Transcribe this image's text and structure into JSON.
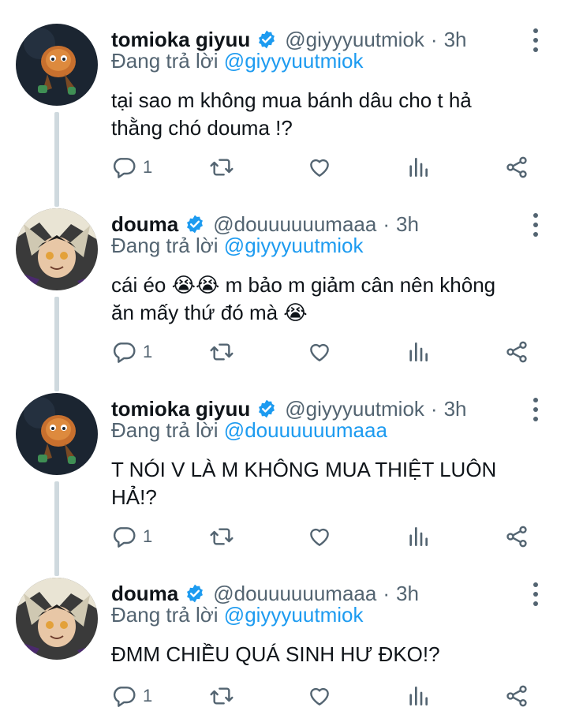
{
  "replying_prefix": "Đang trả lời",
  "tweets": [
    {
      "name": "tomioka giyuu",
      "handle": "@giyyyuutmiok",
      "dot": "·",
      "time": "3h",
      "reply_to": "@giyyyuutmiok",
      "text": "tại sao m không mua bánh dâu cho t hả\nthằng chó douma !?",
      "reply_count": "1",
      "avatar": "giyuu-avatar"
    },
    {
      "name": "douma",
      "handle": "@douuuuuumaaa",
      "dot": "·",
      "time": "3h",
      "reply_to": "@giyyyuutmiok",
      "text_a": "cái éo ",
      "emoji1": "😭😭",
      "text_b": " m bảo m giảm cân nên không\năn mấy thứ đó mà ",
      "emoji2": "😭",
      "reply_count": "1",
      "avatar": "douma-avatar"
    },
    {
      "name": "tomioka giyuu",
      "handle": "@giyyyuutmiok",
      "dot": "·",
      "time": "3h",
      "reply_to": "@douuuuuumaaa",
      "text": "T NÓI V LÀ M KHÔNG MUA THIỆT LUÔN\nHẢ!?",
      "reply_count": "1",
      "avatar": "giyuu-avatar"
    },
    {
      "name": "douma",
      "handle": "@douuuuuumaaa",
      "dot": "·",
      "time": "3h",
      "reply_to": "@giyyyuutmiok",
      "text": "ĐMM CHIỀU QUÁ SINH HƯ ĐKO!?",
      "reply_count": "1",
      "avatar": "douma-avatar"
    }
  ],
  "icons": [
    "verified-badge-icon",
    "more-icon",
    "reply-icon",
    "retweet-icon",
    "like-icon",
    "views-icon",
    "share-icon"
  ],
  "colors": {
    "accent": "#1d9bf0",
    "secondary_text": "#536471",
    "thread_line": "#cfd9de"
  }
}
